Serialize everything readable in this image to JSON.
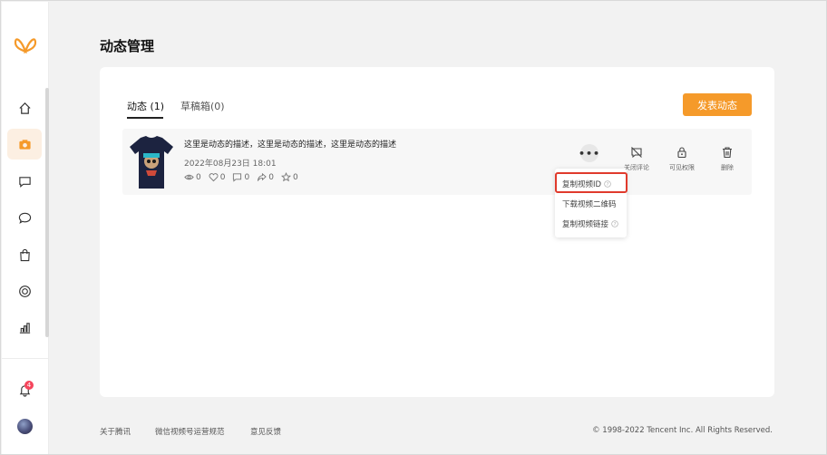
{
  "page": {
    "title": "动态管理"
  },
  "sidebar": {
    "logo": "butterfly-logo",
    "items": [
      {
        "icon": "home-icon"
      },
      {
        "icon": "camera-icon",
        "active": true
      },
      {
        "icon": "message-square-icon"
      },
      {
        "icon": "chat-bubble-icon"
      },
      {
        "icon": "shopping-bag-icon"
      },
      {
        "icon": "target-icon"
      },
      {
        "icon": "bar-chart-icon"
      }
    ],
    "notifications": {
      "icon": "bell-icon",
      "count": "4"
    },
    "avatar": "user-avatar"
  },
  "tabs": [
    {
      "label": "动态 (1)",
      "active": true
    },
    {
      "label": "草稿箱(0)",
      "active": false
    }
  ],
  "publish_label": "发表动态",
  "post": {
    "description": "这里是动态的描述，这里是动态的描述，这里是动态的描述",
    "date": "2022年08月23日 18:01",
    "stats": {
      "views": "0",
      "likes": "0",
      "comments": "0",
      "shares": "0",
      "favorites": "0"
    },
    "actions": [
      {
        "label": "关闭评论",
        "icon": "comment-off-icon"
      },
      {
        "label": "可见权限",
        "icon": "lock-icon"
      },
      {
        "label": "删除",
        "icon": "trash-icon"
      }
    ]
  },
  "more_menu": {
    "items": [
      {
        "label": "复制视频ID",
        "help": true
      },
      {
        "label": "下载视频二维码",
        "help": false
      },
      {
        "label": "复制视频链接",
        "help": true
      }
    ]
  },
  "footer": {
    "links": [
      "关于腾讯",
      "微信视频号运营规范",
      "意见反馈"
    ],
    "copyright": "© 1998-2022 Tencent Inc. All Rights Reserved."
  },
  "colors": {
    "accent": "#f59a2a",
    "highlight": "#e03a2c",
    "badge": "#f5455c"
  }
}
